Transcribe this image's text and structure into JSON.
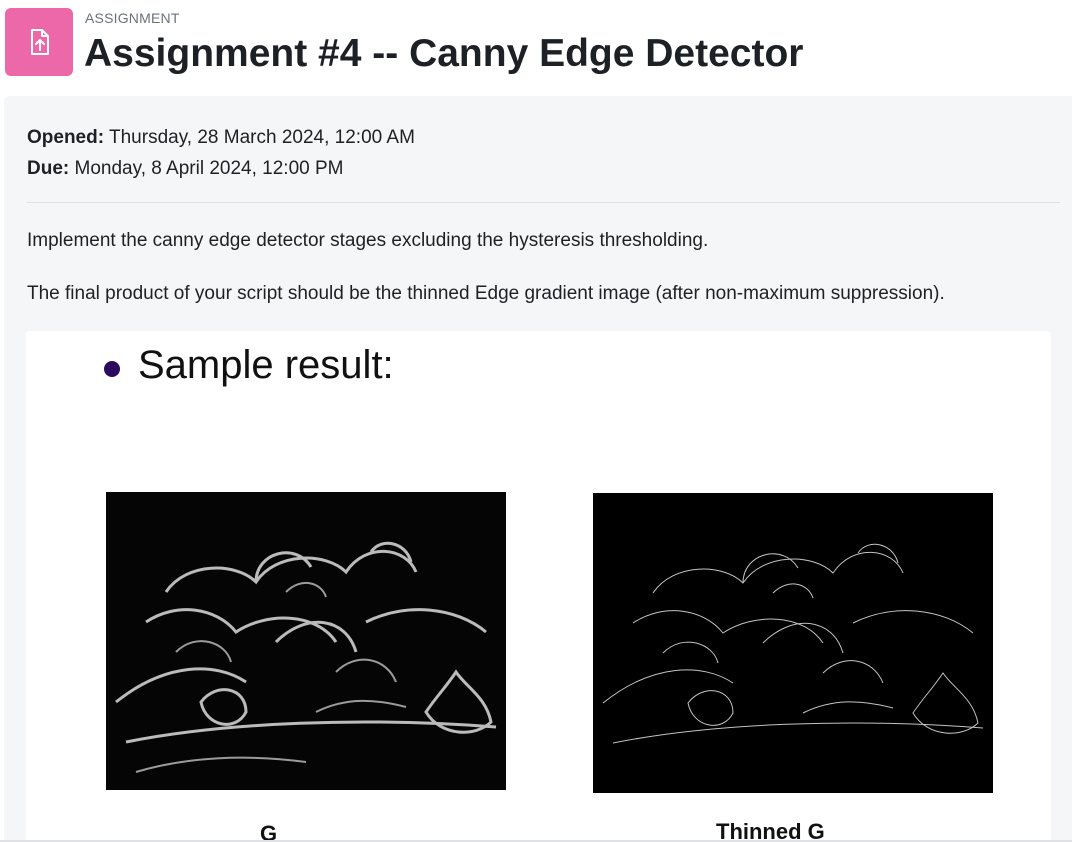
{
  "header": {
    "icon": "file-upload-icon",
    "pretitle": "ASSIGNMENT",
    "title": "Assignment #4 -- Canny Edge Detector",
    "icon_color": "#ec68a8"
  },
  "dates": {
    "opened_label": "Opened:",
    "opened_value": "Thursday, 28 March 2024, 12:00 AM",
    "due_label": "Due:",
    "due_value": "Monday, 8 April 2024, 12:00 PM"
  },
  "description": {
    "line1": "Implement the canny edge detector stages excluding the hysteresis thresholding.",
    "line2": "The final product of your script should be  the thinned Edge gradient image (after non-maximum suppression)."
  },
  "sample": {
    "heading": "Sample result:",
    "bullet_color": "#2e0a5e",
    "images": [
      {
        "caption": "G"
      },
      {
        "caption": "Thinned G"
      }
    ]
  }
}
